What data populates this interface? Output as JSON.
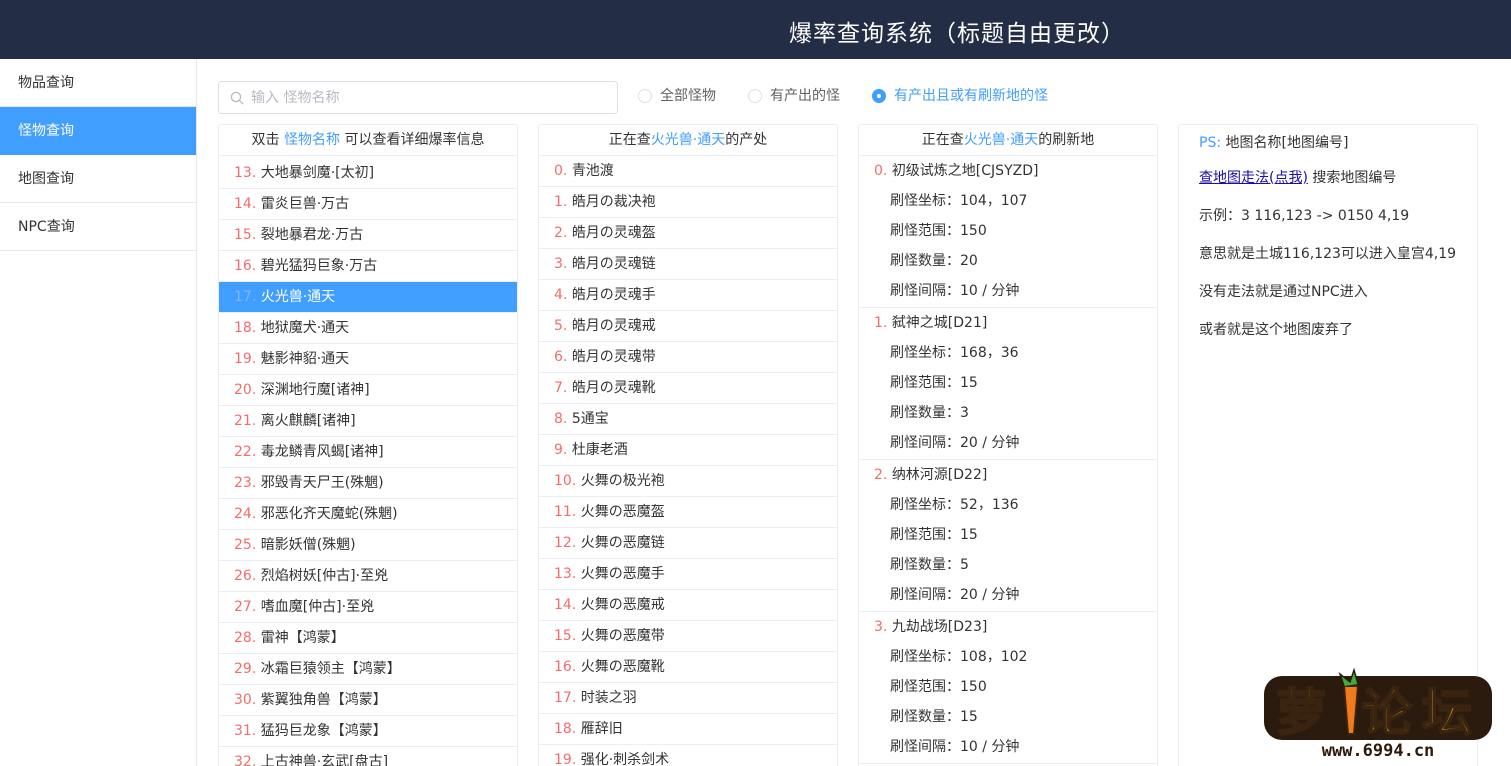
{
  "header": {
    "title": "爆率查询系统（标题自由更改）"
  },
  "sidebar": {
    "items": [
      {
        "label": "物品查询",
        "active": false
      },
      {
        "label": "怪物查询",
        "active": true
      },
      {
        "label": "地图查询",
        "active": false
      },
      {
        "label": "NPC查询",
        "active": false
      }
    ]
  },
  "search": {
    "placeholder": "输入 怪物名称",
    "value": "",
    "icon": "search-icon"
  },
  "filters": {
    "options": [
      {
        "label": "全部怪物",
        "checked": false
      },
      {
        "label": "有产出的怪",
        "checked": false
      },
      {
        "label": "有产出且或有刷新地的怪",
        "checked": true
      }
    ]
  },
  "monster_panel": {
    "hint_prefix": "双击",
    "hint_highlight": "怪物名称",
    "hint_suffix": "可以查看详细爆率信息",
    "rows": [
      {
        "num": "13.",
        "name": "大地暴剑魔·[太初]",
        "selected": false
      },
      {
        "num": "14.",
        "name": "雷炎巨兽·万古",
        "selected": false
      },
      {
        "num": "15.",
        "name": "裂地暴君龙·万古",
        "selected": false
      },
      {
        "num": "16.",
        "name": "碧光猛犸巨象·万古",
        "selected": false
      },
      {
        "num": "17.",
        "name": "火光兽·通天",
        "selected": true
      },
      {
        "num": "18.",
        "name": "地狱魔犬·通天",
        "selected": false
      },
      {
        "num": "19.",
        "name": "魅影神貂·通天",
        "selected": false
      },
      {
        "num": "20.",
        "name": "深渊地行魔[诸神]",
        "selected": false
      },
      {
        "num": "21.",
        "name": "离火麒麟[诸神]",
        "selected": false
      },
      {
        "num": "22.",
        "name": "毒龙鳞青风蝎[诸神]",
        "selected": false
      },
      {
        "num": "23.",
        "name": "邪毁青天尸王(殊魍)",
        "selected": false
      },
      {
        "num": "24.",
        "name": "邪恶化齐天魔蛇(殊魍)",
        "selected": false
      },
      {
        "num": "25.",
        "name": "暗影妖僧(殊魍)",
        "selected": false
      },
      {
        "num": "26.",
        "name": "烈焰树妖[仲古]·至兇",
        "selected": false
      },
      {
        "num": "27.",
        "name": "嗜血魔[仲古]·至兇",
        "selected": false
      },
      {
        "num": "28.",
        "name": "雷神【鸿蒙】",
        "selected": false
      },
      {
        "num": "29.",
        "name": "冰霜巨猿领主【鸿蒙】",
        "selected": false
      },
      {
        "num": "30.",
        "name": "紫翼独角兽【鸿蒙】",
        "selected": false
      },
      {
        "num": "31.",
        "name": "猛犸巨龙象【鸿蒙】",
        "selected": false
      },
      {
        "num": "32.",
        "name": "上古神兽·玄武[盘古]",
        "selected": false
      }
    ]
  },
  "drops_panel": {
    "head_prefix": "正在查",
    "monster": "火光兽·通天",
    "head_suffix": "的产处",
    "rows": [
      {
        "num": "0.",
        "name": "青池渡"
      },
      {
        "num": "1.",
        "name": "皓月の裁决袍"
      },
      {
        "num": "2.",
        "name": "皓月の灵魂盔"
      },
      {
        "num": "3.",
        "name": "皓月の灵魂链"
      },
      {
        "num": "4.",
        "name": "皓月の灵魂手"
      },
      {
        "num": "5.",
        "name": "皓月の灵魂戒"
      },
      {
        "num": "6.",
        "name": "皓月の灵魂带"
      },
      {
        "num": "7.",
        "name": "皓月の灵魂靴"
      },
      {
        "num": "8.",
        "name": "5通宝"
      },
      {
        "num": "9.",
        "name": "杜康老酒"
      },
      {
        "num": "10.",
        "name": "火舞の极光袍"
      },
      {
        "num": "11.",
        "name": "火舞の恶魔盔"
      },
      {
        "num": "12.",
        "name": "火舞の恶魔链"
      },
      {
        "num": "13.",
        "name": "火舞の恶魔手"
      },
      {
        "num": "14.",
        "name": "火舞の恶魔戒"
      },
      {
        "num": "15.",
        "name": "火舞の恶魔带"
      },
      {
        "num": "16.",
        "name": "火舞の恶魔靴"
      },
      {
        "num": "17.",
        "name": "时装之羽"
      },
      {
        "num": "18.",
        "name": "雁辞旧"
      },
      {
        "num": "19.",
        "name": "强化·刺杀剑术"
      }
    ]
  },
  "refresh_panel": {
    "head_prefix": "正在查",
    "monster": "火光兽·通天",
    "head_suffix": "的刷新地",
    "groups": [
      {
        "num": "0.",
        "map": "初级试炼之地[CJSYZD]",
        "coords": "刷怪坐标：104，107",
        "range": "刷怪范围：150",
        "count": "刷怪数量：20",
        "interval": "刷怪间隔：10 / 分钟"
      },
      {
        "num": "1.",
        "map": "弑神之城[D21]",
        "coords": "刷怪坐标：168，36",
        "range": "刷怪范围：15",
        "count": "刷怪数量：3",
        "interval": "刷怪间隔：20 / 分钟"
      },
      {
        "num": "2.",
        "map": "纳林河源[D22]",
        "coords": "刷怪坐标：52，136",
        "range": "刷怪范围：15",
        "count": "刷怪数量：5",
        "interval": "刷怪间隔：20 / 分钟"
      },
      {
        "num": "3.",
        "map": "九劫战场[D23]",
        "coords": "刷怪坐标：108，102",
        "range": "刷怪范围：150",
        "count": "刷怪数量：15",
        "interval": "刷怪间隔：10 / 分钟"
      }
    ]
  },
  "notes_panel": {
    "ps_label": "PS:",
    "ps_text": "地图名称[地图编号]",
    "link_text": "查地图走法(点我)",
    "link_suffix": "搜索地图编号",
    "example": "示例：3 116,123 -> 0150 4,19",
    "meaning": "意思就是土城116,123可以进入皇宫4,19",
    "no_route": "没有走法就是通过NPC进入",
    "abandoned": "或者就是这个地图废弃了"
  },
  "watermark": {
    "brand": "萝卜论坛",
    "url": "www.6994.cn"
  },
  "colors": {
    "header_bg": "#232d45",
    "accent": "#409eff",
    "index_red": "#f56c6c"
  }
}
